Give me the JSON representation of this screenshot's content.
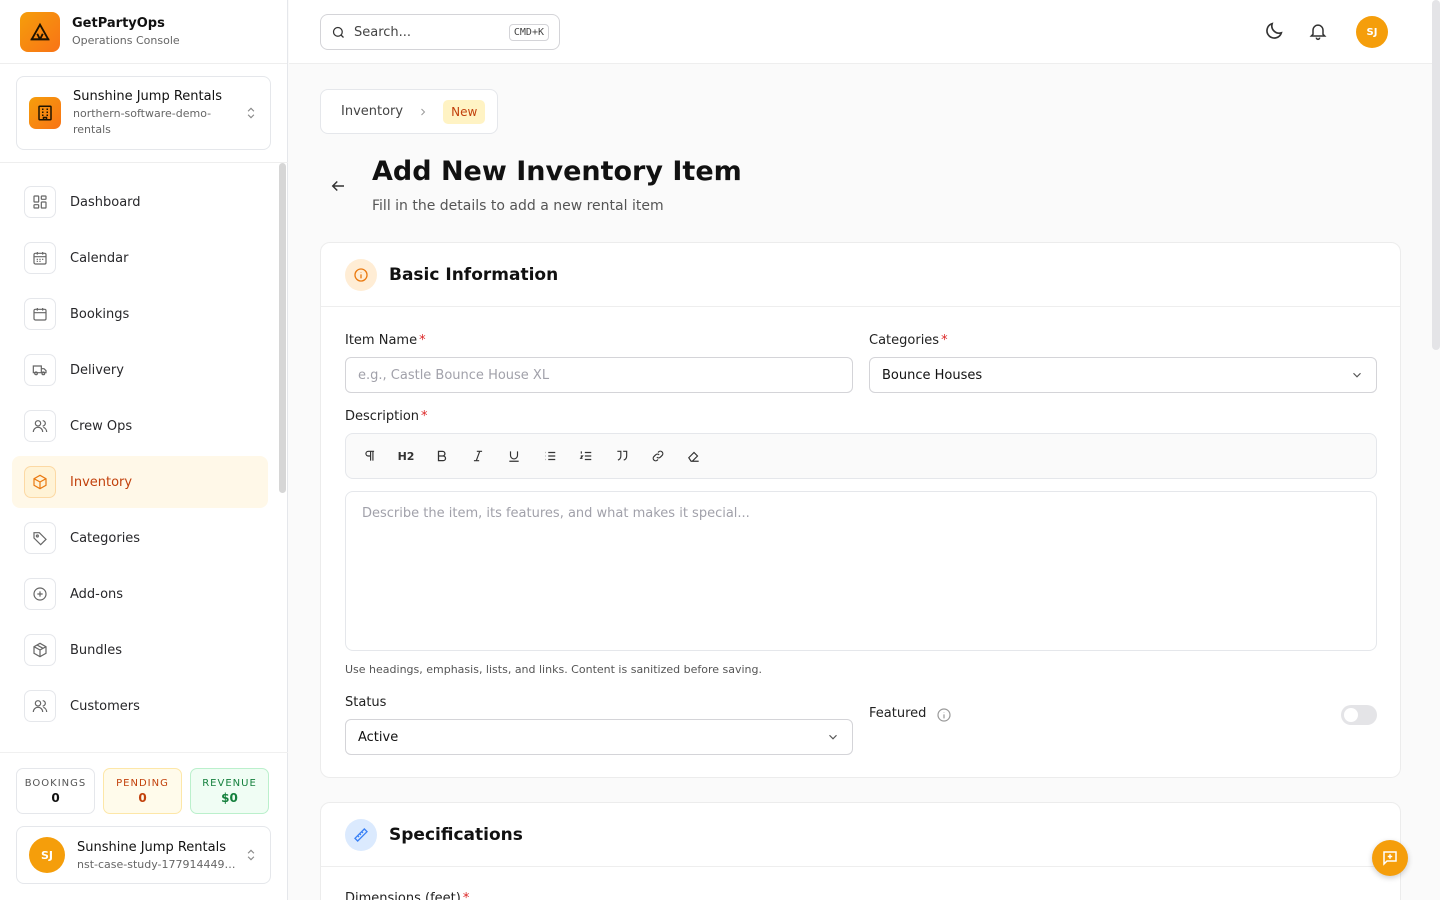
{
  "brand": {
    "name": "GetPartyOps",
    "subtitle": "Operations Console"
  },
  "org": {
    "name": "Sunshine Jump Rentals",
    "slug": "northern-software-demo-rentals"
  },
  "nav": {
    "items": [
      {
        "label": "Dashboard",
        "icon": "grid-icon"
      },
      {
        "label": "Calendar",
        "icon": "calendar-grid-icon"
      },
      {
        "label": "Bookings",
        "icon": "calendar-icon"
      },
      {
        "label": "Delivery",
        "icon": "truck-icon"
      },
      {
        "label": "Crew Ops",
        "icon": "users-icon"
      },
      {
        "label": "Inventory",
        "icon": "box-icon",
        "active": true
      },
      {
        "label": "Categories",
        "icon": "tag-icon"
      },
      {
        "label": "Add-ons",
        "icon": "plus-circle-icon"
      },
      {
        "label": "Bundles",
        "icon": "package-icon"
      },
      {
        "label": "Customers",
        "icon": "users-icon"
      }
    ]
  },
  "stats": {
    "bookings": {
      "label": "BOOKINGS",
      "value": "0"
    },
    "pending": {
      "label": "PENDING",
      "value": "0"
    },
    "revenue": {
      "label": "REVENUE",
      "value": "$0"
    }
  },
  "user": {
    "initials": "SJ",
    "name": "Sunshine Jump Rentals",
    "email": "nst-case-study-1779144491..."
  },
  "topbar": {
    "search_placeholder": "Search...",
    "shortcut": "CMD+K",
    "avatar_initials": "SJ"
  },
  "breadcrumb": {
    "parent": "Inventory",
    "current": "New"
  },
  "page": {
    "title": "Add New Inventory Item",
    "subtitle": "Fill in the details to add a new rental item"
  },
  "basic": {
    "title": "Basic Information",
    "item_name_label": "Item Name",
    "item_name_placeholder": "e.g., Castle Bounce House XL",
    "categories_label": "Categories",
    "categories_value": "Bounce Houses",
    "description_label": "Description",
    "description_placeholder": "Describe the item, its features, and what makes it special...",
    "help_text": "Use headings, emphasis, lists, and links. Content is sanitized before saving.",
    "status_label": "Status",
    "status_value": "Active",
    "featured_label": "Featured",
    "featured_on": false,
    "toolbar": {
      "h2": "H2"
    }
  },
  "specs": {
    "title": "Specifications",
    "dimensions_label": "Dimensions (feet)"
  },
  "colors": {
    "accent": "#f59e0b",
    "accent_text": "#c2410c",
    "required": "#dc2626"
  }
}
